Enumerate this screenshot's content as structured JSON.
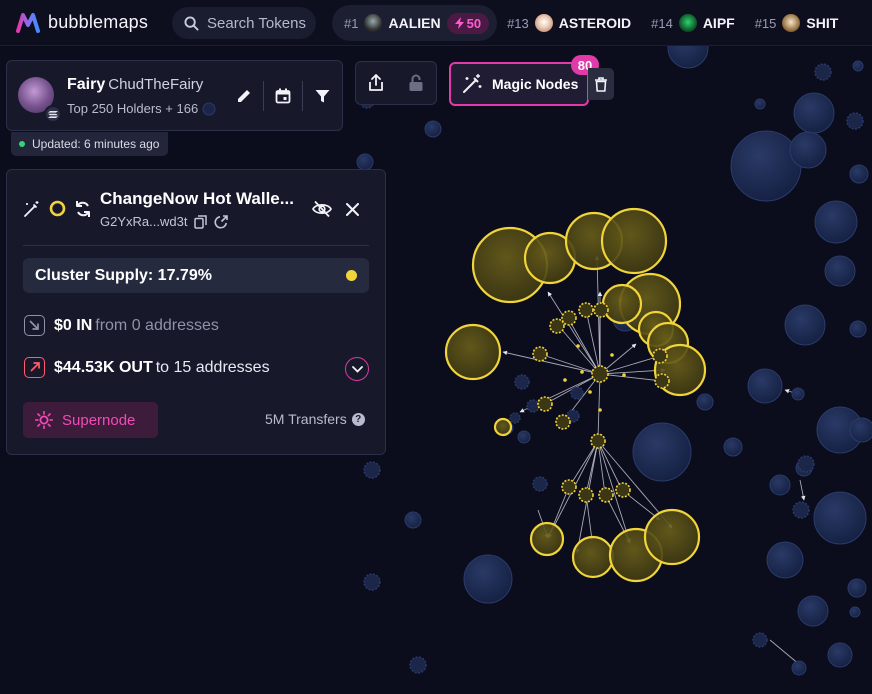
{
  "app": {
    "logo_text": "bubblemaps",
    "brand_colors": [
      "#e23aa9",
      "#8a6cf0",
      "#3f8cff"
    ]
  },
  "search": {
    "placeholder": "Search Tokens"
  },
  "trending": [
    {
      "rank": "#1",
      "symbol": "AALIEN",
      "boost": "50",
      "icon": "alien-icon"
    },
    {
      "rank": "#13",
      "symbol": "ASTEROID",
      "icon": "astronaut-icon"
    },
    {
      "rank": "#14",
      "symbol": "AIPF",
      "icon": "leaf-icon"
    },
    {
      "rank": "#15",
      "symbol": "SHIT",
      "icon": "coin-icon"
    }
  ],
  "token_card": {
    "name": "Fairy",
    "handle": "ChudTheFairy",
    "subtitle": "Top 250 Holders + 166",
    "updated": "Updated: 6 minutes ago",
    "tools": [
      "edit-icon",
      "calendar-icon",
      "filter-icon"
    ]
  },
  "magic_nodes": {
    "label": "Magic Nodes",
    "count": "80"
  },
  "wallet_panel": {
    "name": "ChangeNow Hot Walle...",
    "address": "G2YxRa...wd3t",
    "cluster_supply": "Cluster Supply: 17.79%",
    "in": {
      "amount": "$0 IN",
      "detail": "from 0 addresses"
    },
    "out": {
      "amount": "$44.53K OUT",
      "detail": "to 15 addresses"
    },
    "supernode_label": "Supernode",
    "transfers": "5M Transfers",
    "colors": {
      "cluster": "#f0d43a",
      "accent": "#e23aa9"
    }
  }
}
